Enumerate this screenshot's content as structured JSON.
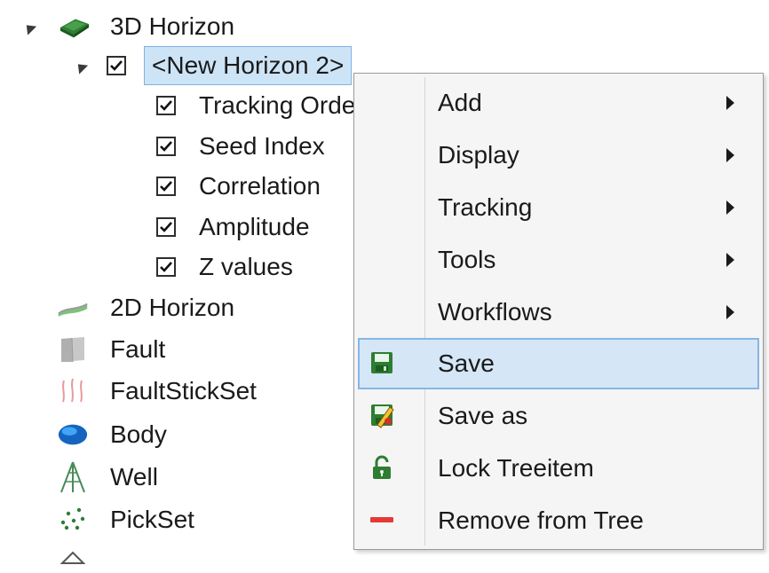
{
  "tree": {
    "root": {
      "label": "3D Horizon",
      "icon": "3d-horizon-icon"
    },
    "child": {
      "label": "<New Horizon 2>",
      "checked": true
    },
    "attributes": [
      {
        "label": "Tracking Order",
        "checked": true
      },
      {
        "label": "Seed Index",
        "checked": true
      },
      {
        "label": "Correlation",
        "checked": true
      },
      {
        "label": "Amplitude",
        "checked": true
      },
      {
        "label": "Z values",
        "checked": true
      }
    ],
    "items": [
      {
        "label": "2D Horizon",
        "icon": "2d-horizon-icon"
      },
      {
        "label": "Fault",
        "icon": "fault-icon"
      },
      {
        "label": "FaultStickSet",
        "icon": "faultstickset-icon"
      },
      {
        "label": "Body",
        "icon": "body-icon"
      },
      {
        "label": "Well",
        "icon": "well-icon"
      },
      {
        "label": "PickSet",
        "icon": "pickset-icon"
      }
    ]
  },
  "context_menu": {
    "items": [
      {
        "label": "Add",
        "submenu": true
      },
      {
        "label": "Display",
        "submenu": true
      },
      {
        "label": "Tracking",
        "submenu": true
      },
      {
        "label": "Tools",
        "submenu": true
      },
      {
        "label": "Workflows",
        "submenu": true
      },
      {
        "label": "Save",
        "icon": "save-icon",
        "highlighted": true
      },
      {
        "label": "Save as",
        "icon": "save-as-icon"
      },
      {
        "label": "Lock Treeitem",
        "icon": "lock-icon"
      },
      {
        "label": "Remove from Tree",
        "icon": "remove-icon"
      }
    ]
  },
  "colors": {
    "selection_bg": "#cde4f7",
    "selection_border": "#7fb2e0",
    "menu_bg": "#f5f5f5",
    "menu_highlight_bg": "#d5e6f6",
    "menu_highlight_border": "#86b6e6"
  }
}
